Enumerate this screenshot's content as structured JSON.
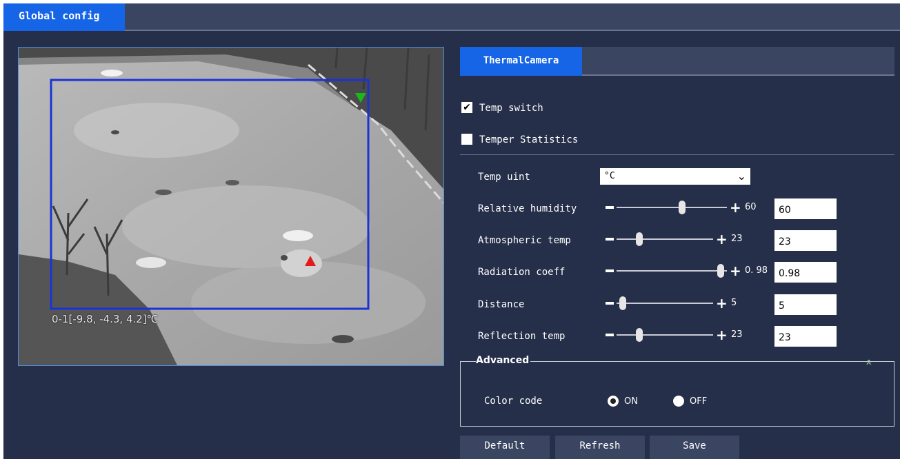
{
  "header": {
    "tab_label": "Global config"
  },
  "preview": {
    "temp_readout": "0-1[-9.8, -4.3, 4.2]℃"
  },
  "panel": {
    "tab_label": "ThermalCamera",
    "temp_switch": {
      "label": "Temp switch",
      "checked": true,
      "check_glyph": "✔"
    },
    "temper_statistics": {
      "label": "Temper Statistics",
      "checked": false
    },
    "temp_unit": {
      "label": "Temp uint",
      "value": "°C",
      "chevron": "⌄"
    },
    "sliders": [
      {
        "label": "Relative humidity",
        "value": "60",
        "display": "60"
      },
      {
        "label": "Atmospheric temp",
        "value": "23",
        "display": "23"
      },
      {
        "label": "Radiation coeff",
        "value": "0.98",
        "display": "0. 98"
      },
      {
        "label": "Distance",
        "value": "5",
        "display": "5"
      },
      {
        "label": "Reflection temp",
        "value": "23",
        "display": "23"
      }
    ],
    "advanced": {
      "title": "Advanced",
      "collapse_glyph": "»",
      "color_code": {
        "label": "Color code",
        "on_label": "ON",
        "off_label": "OFF",
        "selected": "ON"
      }
    },
    "buttons": {
      "default": "Default",
      "refresh": "Refresh",
      "save": "Save"
    }
  },
  "colors": {
    "accent": "#1565e6",
    "background": "#262f49",
    "bar": "#3a4562",
    "roi": "#1a33d6",
    "marker_max": "#e41b1b",
    "marker_min": "#19b81e"
  }
}
